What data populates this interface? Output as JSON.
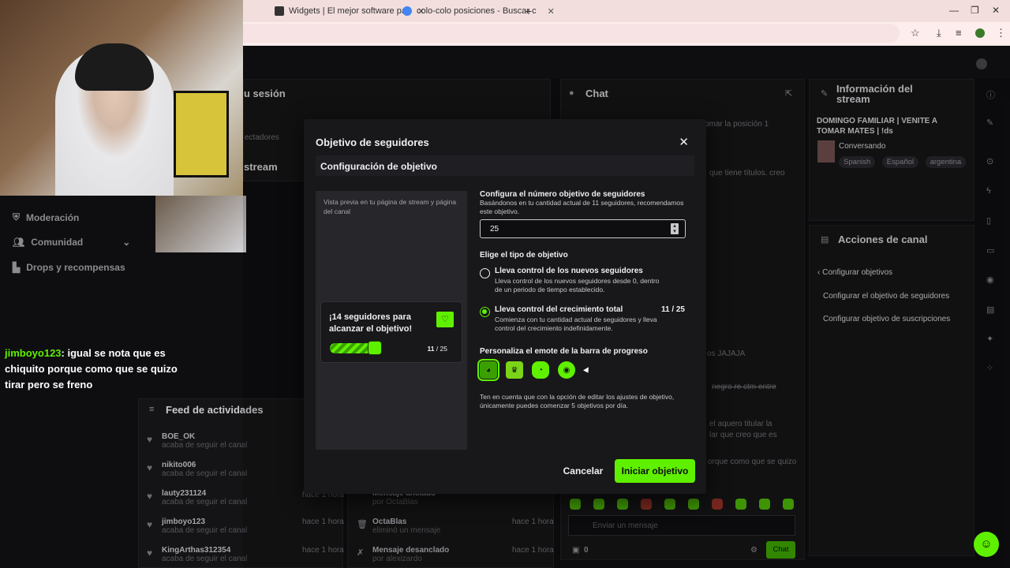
{
  "browser": {
    "tabs": [
      {
        "label": "Widgets | El mejor software pa"
      },
      {
        "label": "colo-colo posiciones - Buscar c"
      }
    ],
    "new_tab": "+"
  },
  "background": {
    "session_title": "u sesión",
    "spectators_label": "ectadores",
    "stream_label": "stream",
    "chat_title": "Chat",
    "chat_snippet_1": "omar la posición 1",
    "chat_snippet_2": "que tiene títulos. creo",
    "chat_snippet_3": "os JAJAJA",
    "chat_snippet_4": "negro re ctm entre",
    "chat_snippet_5": "el aquero titular la",
    "chat_snippet_6": "lar que creo que es",
    "chat_snippet_7": "orque como que se quizo",
    "stream_info_title": "Información del stream",
    "stream_info_name": "DOMINGO FAMILIAR | VENITE A TOMAR MATES | !ds",
    "stream_info_category": "Conversando",
    "stream_info_tags": [
      "Spanish",
      "Español",
      "argentina"
    ],
    "channel_actions_title": "Acciones de canal",
    "channel_actions": [
      "Configurar objetivos",
      "Configurar el objetivo de seguidores",
      "Configurar objetivo de suscripciones"
    ],
    "sidebar": [
      "Moderación",
      "Comunidad",
      "Drops y recompensas"
    ],
    "feed_title": "Feed de actividades",
    "feed_items": [
      {
        "name": "BOE_OK",
        "sub": "acaba de seguir el canal",
        "time": ""
      },
      {
        "name": "nikito006",
        "sub": "acaba de seguir el canal",
        "time": ""
      },
      {
        "name": "lauty231124",
        "sub": "acaba de seguir el canal",
        "time": "hace 1 hora"
      },
      {
        "name": "jimboyo123",
        "sub": "acaba de seguir el canal",
        "time": "hace 1 hora"
      },
      {
        "name": "KingArthas312354",
        "sub": "acaba de seguir el canal",
        "time": "hace 1 hora"
      }
    ],
    "mod_items": [
      {
        "name": "Mensaje anclado",
        "sub": "por OctaBlas",
        "time": ""
      },
      {
        "name": "OctaBlas",
        "sub": "eliminó un mensaje",
        "time": "hace 1 hora"
      },
      {
        "name": "Mensaje desanclado",
        "sub": "por alexizardo",
        "time": "hace 1 hora"
      }
    ],
    "chat_placeholder": "Enviar un mensaje",
    "chat_points": "0",
    "chat_button": "Chat"
  },
  "overlay_chat": {
    "user": "jimboyo123",
    "message": ": igual se nota que es chiquito porque como que se quizo tirar pero se freno"
  },
  "modal": {
    "title": "Objetivo de seguidores",
    "section": "Configuración de objetivo",
    "preview_hint": "Vista previa en tu página de stream y página del canal",
    "preview_text": "¡14 seguidores para alcanzar el objetivo!",
    "preview_count_current": "11",
    "preview_count_total": " / 25",
    "target_label": "Configura el número objetivo de seguidores",
    "target_hint": "Basándonos en tu cantidad actual de 11 seguidores, recomendamos este objetivo.",
    "target_value": "25",
    "type_label": "Elige el tipo de objetivo",
    "option_new_title": "Lleva control de los nuevos seguidores",
    "option_new_desc": "Lleva control de los nuevos seguidores desde 0, dentro de un periodo de tiempo establecido.",
    "option_total_title": "Lleva control del crecimiento total",
    "option_total_desc": "Comienza con tu cantidad actual de seguidores y lleva control del crecimiento indefinidamente.",
    "option_total_count": "11 / 25",
    "selected_option": "total",
    "emote_label": "Personaliza el emote de la barra de progreso",
    "notice": "Ten en cuenta que con la opción de editar los ajustes de objetivo, únicamente puedes comenzar 5 objetivos por día.",
    "cancel_label": "Cancelar",
    "start_label": "Iniciar objetivo",
    "progress": 0.44
  },
  "colors": {
    "accent": "#5ff000",
    "modal_bg": "#18181b",
    "page_bg": "#0e0e10"
  }
}
